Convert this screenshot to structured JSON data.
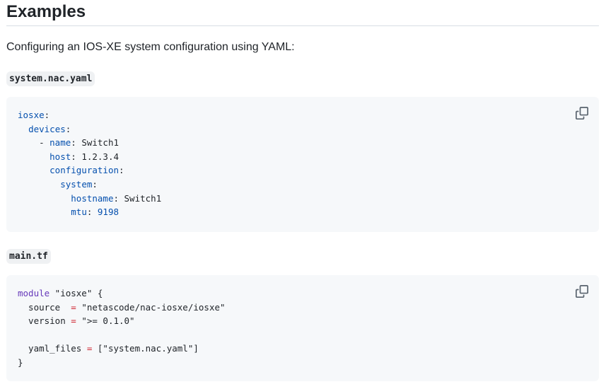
{
  "heading": "Examples",
  "intro": "Configuring an IOS-XE system configuration using YAML:",
  "blocks": [
    {
      "filename": "system.nac.yaml",
      "lines": [
        [
          {
            "t": "iosxe",
            "c": "k"
          },
          {
            "t": ":",
            "c": ""
          }
        ],
        [
          {
            "t": "  ",
            "c": ""
          },
          {
            "t": "devices",
            "c": "k"
          },
          {
            "t": ":",
            "c": ""
          }
        ],
        [
          {
            "t": "    - ",
            "c": ""
          },
          {
            "t": "name",
            "c": "k"
          },
          {
            "t": ": Switch1",
            "c": ""
          }
        ],
        [
          {
            "t": "      ",
            "c": ""
          },
          {
            "t": "host",
            "c": "k"
          },
          {
            "t": ": 1.2.3.4",
            "c": ""
          }
        ],
        [
          {
            "t": "      ",
            "c": ""
          },
          {
            "t": "configuration",
            "c": "k"
          },
          {
            "t": ":",
            "c": ""
          }
        ],
        [
          {
            "t": "        ",
            "c": ""
          },
          {
            "t": "system",
            "c": "k"
          },
          {
            "t": ":",
            "c": ""
          }
        ],
        [
          {
            "t": "          ",
            "c": ""
          },
          {
            "t": "hostname",
            "c": "k"
          },
          {
            "t": ": Switch1",
            "c": ""
          }
        ],
        [
          {
            "t": "          ",
            "c": ""
          },
          {
            "t": "mtu",
            "c": "k"
          },
          {
            "t": ": ",
            "c": ""
          },
          {
            "t": "9198",
            "c": "n"
          }
        ]
      ]
    },
    {
      "filename": "main.tf",
      "lines": [
        [
          {
            "t": "module",
            "c": "kw"
          },
          {
            "t": " \"iosxe\" {",
            "c": ""
          }
        ],
        [
          {
            "t": "  source  ",
            "c": ""
          },
          {
            "t": "=",
            "c": "op"
          },
          {
            "t": " \"netascode/nac-iosxe/iosxe\"",
            "c": ""
          }
        ],
        [
          {
            "t": "  version ",
            "c": ""
          },
          {
            "t": "=",
            "c": "op"
          },
          {
            "t": " \">= 0.1.0\"",
            "c": ""
          }
        ],
        [
          {
            "t": "",
            "c": ""
          }
        ],
        [
          {
            "t": "  yaml_files ",
            "c": ""
          },
          {
            "t": "=",
            "c": "op"
          },
          {
            "t": " [\"system.nac.yaml\"]",
            "c": ""
          }
        ],
        [
          {
            "t": "}",
            "c": ""
          }
        ]
      ]
    }
  ],
  "icons": {
    "copy": "copy-icon"
  },
  "colors": {
    "key": "#0550ae",
    "keyword": "#6639ba",
    "operator": "#cf222e",
    "code_bg": "#f6f8fa"
  }
}
